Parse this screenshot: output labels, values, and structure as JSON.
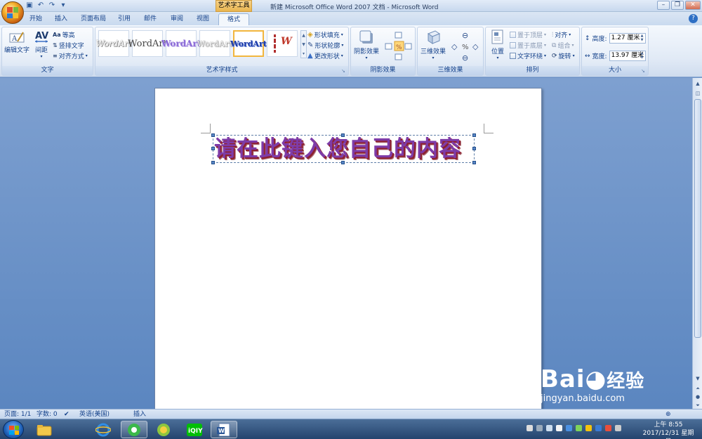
{
  "window": {
    "title": "新建 Microsoft Office Word 2007 文档 - Microsoft Word",
    "contextual_tab": "艺术字工具"
  },
  "tabs": [
    "开始",
    "插入",
    "页面布局",
    "引用",
    "邮件",
    "审阅",
    "视图",
    "格式"
  ],
  "active_tab": "格式",
  "ribbon": {
    "text_group": {
      "label": "文字",
      "edit_text": "编辑文字",
      "spacing": "间距",
      "even_height": "等高",
      "vertical_text": "竖排文字",
      "align": "对齐方式"
    },
    "styles_group": {
      "label": "艺术字样式",
      "styles": [
        "WordArt",
        "WordArt",
        "WordArt",
        "WordArt",
        "WordArt"
      ],
      "fill": "形状填充",
      "outline": "形状轮廓",
      "change_shape": "更改形状"
    },
    "shadow_group": {
      "label": "阴影效果",
      "shadow": "阴影效果"
    },
    "threed_group": {
      "label": "三维效果",
      "threed": "三维效果"
    },
    "arrange_group": {
      "label": "排列",
      "position": "位置",
      "bring_front": "置于顶层",
      "send_back": "置于底层",
      "text_wrap": "文字环绕",
      "align": "对齐",
      "group": "组合",
      "rotate": "旋转"
    },
    "size_group": {
      "label": "大小",
      "height_label": "高度:",
      "height_value": "1.27 厘米",
      "width_label": "宽度:",
      "width_value": "13.97 厘米"
    }
  },
  "document": {
    "wordart_text": "请在此键入您自己的内容"
  },
  "statusbar": {
    "page": "页面: 1/1",
    "words": "字数: 0",
    "language": "英语(美国)",
    "mode": "插入"
  },
  "taskbar": {
    "time": "上午 8:55",
    "date": "2017/12/31 星期日"
  },
  "watermark": {
    "brand": "Bai",
    "brand_cn": "经验",
    "url": "jingyan.baidu.com"
  },
  "colors": {
    "ribbon_text": "#15428b",
    "wordart_fill": "#7e3ca8",
    "wordart_shadow": "#8e2030",
    "doc_bg": "#6f94c8"
  }
}
